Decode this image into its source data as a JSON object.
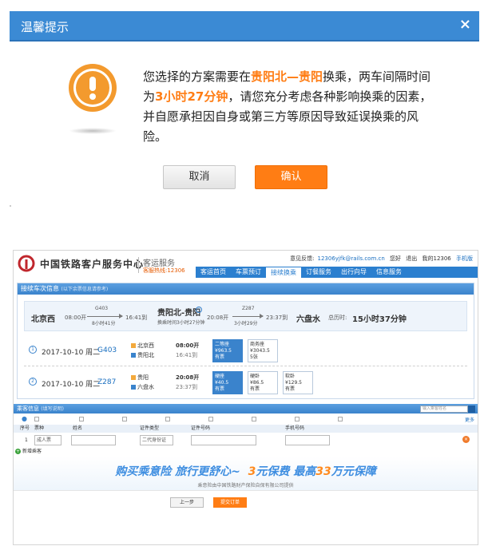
{
  "dialog": {
    "title": "温馨提示",
    "close": "×",
    "msg": {
      "p1": "您选择的方案需要在",
      "h1": "贵阳北—贵阳",
      "p2": "换乘，两车间隔时间为",
      "h2": "3小时27分钟",
      "p3": "，请您充分考虑各种影响换乘的因素，并自愿承担因自身或第三方等原因导致延误换乘的风险。"
    },
    "cancel_label": "取消",
    "confirm_label": "确认"
  },
  "colors": {
    "dialog_header": "#3b8ad4",
    "accent_orange": "#ff7d14",
    "nav_blue": "#2b7fcf"
  },
  "site": {
    "name": "中国铁路客户服务中心",
    "sub": "客运服务",
    "hotline": "客服热线:12306",
    "feedback_label": "意见反馈:",
    "feedback_email": "12306yjfk@rails.com.cn",
    "greeting": "您好",
    "logout": "退出",
    "my12306": "我的12306",
    "mobile": "手机版",
    "nav": [
      "客运首页",
      "车票预订",
      "接续换乘",
      "订餐服务",
      "出行向导",
      "信息服务"
    ],
    "nav_active": 2
  },
  "panel": {
    "title": "接续车次信息",
    "hint": "(以下余票信息请参考)"
  },
  "route": {
    "from": "北京西",
    "dep1": "08:00开",
    "train1": "G403",
    "dur1": "8小时41分",
    "arr1": "16:41到",
    "transfer": "贵阳北-贵阳",
    "transfer_note": "换乘时间3小时27分钟",
    "dep2": "20:08开",
    "train2": "Z287",
    "dur2": "3小时29分",
    "arr2": "23:37到",
    "to": "六盘水",
    "total_label": "总历时:",
    "total": "15小时37分钟"
  },
  "trains": [
    {
      "idx": "1",
      "date": "2017-10-10 周二",
      "no": "G403",
      "from_st": "北京西",
      "to_st": "贵阳北",
      "dep": "08:00开",
      "arr": "16:41到",
      "seats": [
        {
          "name": "二等座",
          "price": "¥963.5",
          "stock": "有票",
          "selected": true
        },
        {
          "name": "商务座",
          "price": "¥3043.5",
          "stock": "5张",
          "selected": false
        }
      ]
    },
    {
      "idx": "2",
      "date": "2017-10-10 周二",
      "no": "Z287",
      "from_st": "贵阳",
      "to_st": "六盘水",
      "dep": "20:08开",
      "arr": "23:37到",
      "seats": [
        {
          "name": "硬座",
          "price": "¥40.5",
          "stock": "有票",
          "selected": true
        },
        {
          "name": "硬卧",
          "price": "¥86.5",
          "stock": "有票",
          "selected": false
        },
        {
          "name": "软卧",
          "price": "¥129.5",
          "stock": "有票",
          "selected": false
        }
      ]
    }
  ],
  "passenger": {
    "title": "乘客信息",
    "hint": "(填写说明)",
    "search_placeholder": "输入乘客姓名",
    "more": "更多",
    "cols": [
      "序号",
      "票种",
      "姓名",
      "证件类型",
      "证件号码",
      "手机号码"
    ],
    "row_idx": "1",
    "ticket_type": "成人票",
    "id_type": "二代身份证",
    "add": "新增乘客"
  },
  "insurance": {
    "t1": "购买乘意险  旅行更舒心~",
    "t2a": "3",
    "t2b": "元保费  最高",
    "t2c": "33",
    "t2d": "万元保障",
    "sub": "乘意险由中国铁路财产保险自保有限公司提供"
  },
  "footer": {
    "prev": "上一步",
    "submit": "提交订单"
  }
}
